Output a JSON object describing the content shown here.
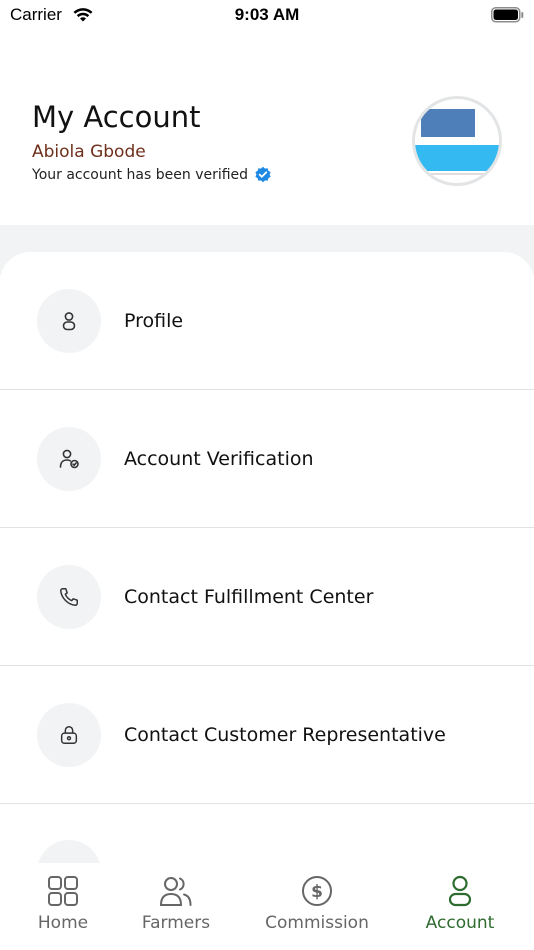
{
  "status_bar": {
    "carrier": "Carrier",
    "time": "9:03 AM"
  },
  "header": {
    "title": "My Account",
    "user_name": "Abiola Gbode",
    "verified_text": "Your account has been verified"
  },
  "menu": [
    {
      "label": "Profile",
      "icon": "person-icon"
    },
    {
      "label": "Account Verification",
      "icon": "user-check-icon"
    },
    {
      "label": "Contact Fulfillment Center",
      "icon": "phone-icon"
    },
    {
      "label": "Contact Customer Representative",
      "icon": "lock-icon"
    }
  ],
  "tabs": [
    {
      "label": "Home",
      "icon": "grid-icon"
    },
    {
      "label": "Farmers",
      "icon": "users-icon"
    },
    {
      "label": "Commission",
      "icon": "dollar-circle-icon"
    },
    {
      "label": "Account",
      "icon": "person-icon",
      "active": true
    }
  ],
  "colors": {
    "accent_green": "#2e6b2f",
    "name_brown": "#6e2f1b",
    "verified_blue": "#1e88e5",
    "icon_bg": "#f2f3f4"
  }
}
